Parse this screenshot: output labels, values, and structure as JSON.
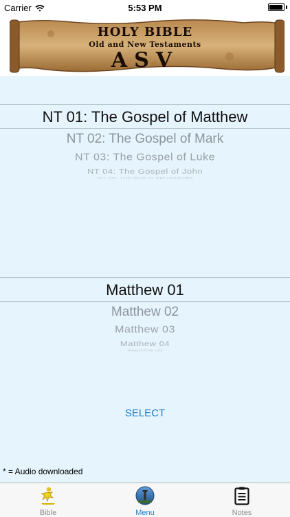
{
  "status_bar": {
    "carrier": "Carrier",
    "time": "5:53 PM",
    "battery_level": 0.95
  },
  "banner": {
    "title": "HOLY BIBLE",
    "subtitle": "Old and New Testaments",
    "version": "ASV"
  },
  "book_picker": {
    "selected": "NT 01: The Gospel of Matthew",
    "items": [
      "NT 02: The Gospel of Mark",
      "NT 03: The Gospel of Luke",
      "NT 04: The Gospel of John",
      "NT 05: The Acts of the Apostles"
    ]
  },
  "chapter_picker": {
    "selected": "Matthew 01",
    "items": [
      "Matthew 02",
      "Matthew 03",
      "Matthew 04",
      "Matthew 05"
    ]
  },
  "select_button": "SELECT",
  "legend": "* = Audio downloaded",
  "tabs": [
    {
      "label": "Bible",
      "icon": "bible-figure-icon",
      "active": false
    },
    {
      "label": "Menu",
      "icon": "lighthouse-icon",
      "active": true
    },
    {
      "label": "Notes",
      "icon": "clipboard-icon",
      "active": false
    }
  ],
  "colors": {
    "background": "#e6f4fd",
    "accent": "#1f7fc4",
    "tab_inactive": "#8e8e93"
  }
}
